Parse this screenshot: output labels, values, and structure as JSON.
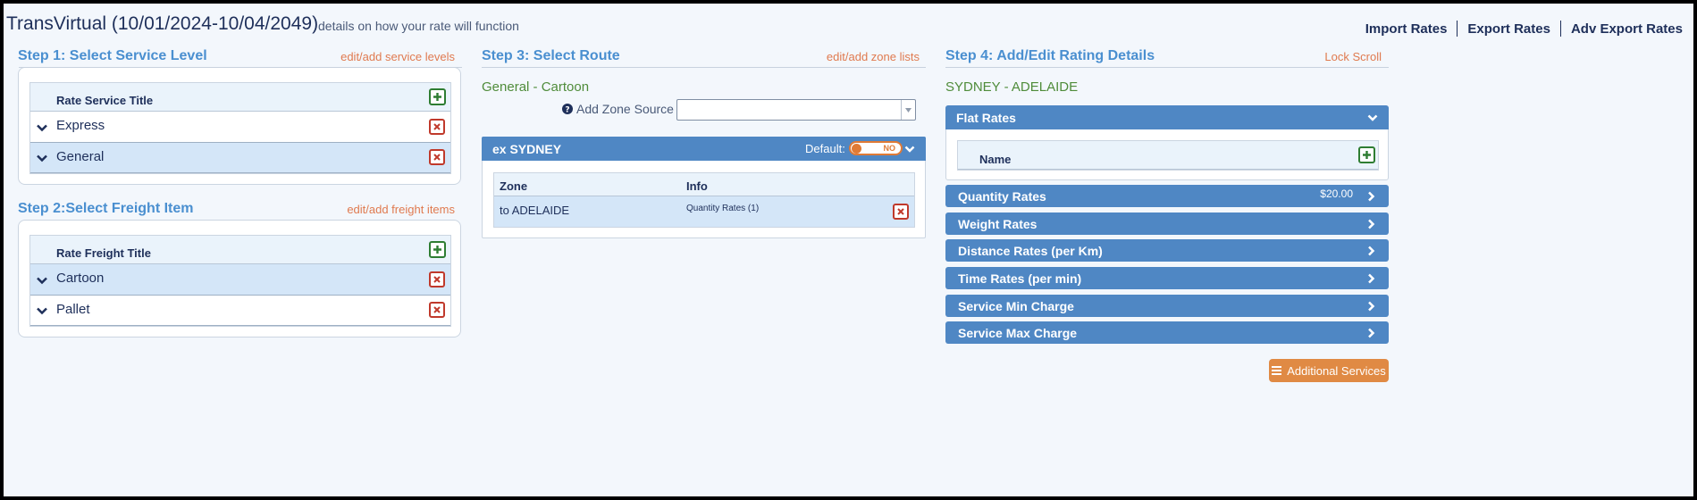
{
  "header": {
    "title": "TransVirtual (10/01/2024-10/04/2049)",
    "subtitle": "details on how your rate will function",
    "links": [
      "Import Rates",
      "Export Rates",
      "Adv Export Rates"
    ]
  },
  "step1": {
    "title": "Step 1: Select Service Level",
    "link": "edit/add service levels",
    "column": "Rate Service Title",
    "rows": [
      {
        "label": "Express",
        "selected": false
      },
      {
        "label": "General",
        "selected": true
      }
    ]
  },
  "step2": {
    "title": "Step 2:Select Freight Item",
    "link": "edit/add freight items",
    "column": "Rate Freight Title",
    "rows": [
      {
        "label": "Cartoon",
        "selected": true
      },
      {
        "label": "Pallet",
        "selected": false
      }
    ]
  },
  "step3": {
    "title": "Step 3: Select Route",
    "link": "edit/add zone lists",
    "selection": "General - Cartoon",
    "zone_source_label": "Add Zone Source",
    "zone_source_value": "",
    "panel": {
      "title": "ex SYDNEY",
      "default_label": "Default:",
      "toggle_text": "NO",
      "columns": [
        "Zone",
        "Info"
      ],
      "rows": [
        {
          "zone": "to ADELAIDE",
          "info": "Quantity Rates (1)"
        }
      ]
    }
  },
  "step4": {
    "title": "Step 4: Add/Edit Rating Details",
    "link": "Lock Scroll",
    "route": "SYDNEY - ADELAIDE",
    "flat_rates": {
      "label": "Flat Rates",
      "column": "Name"
    },
    "sections": [
      {
        "label": "Quantity Rates",
        "value": "$20.00"
      },
      {
        "label": "Weight Rates",
        "value": ""
      },
      {
        "label": "Distance Rates (per Km)",
        "value": ""
      },
      {
        "label": "Time Rates (per min)",
        "value": ""
      },
      {
        "label": "Service Min Charge",
        "value": ""
      },
      {
        "label": "Service Max Charge",
        "value": ""
      }
    ],
    "additional_services": "Additional Services"
  },
  "colors": {
    "accent_blue": "#4f87c4",
    "step_title": "#4a8fd0",
    "link_orange": "#e07a4f",
    "button_orange": "#e08a44",
    "selected_row": "#d4e6f8"
  }
}
